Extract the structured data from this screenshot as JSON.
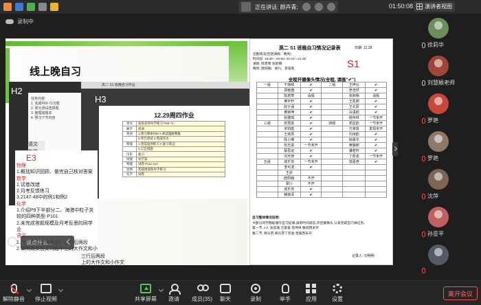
{
  "topbar": {
    "speaking_label": "正在讲话: 颜卉青;",
    "clock": "01:50:08",
    "view_label": "演讲者视图"
  },
  "recording_label": "录制中",
  "slide": {
    "title": "线上晚自习",
    "h2_label": "H2",
    "h2_lines": [
      "任务内容:",
      "1. 完成P69-72习题",
      "2. 单元测试选择题",
      "3. 整理错题本",
      "4. 预习下节内容"
    ],
    "h2_tabs": [
      "语文",
      "数学",
      "",
      "英语",
      "物理",
      "历史"
    ],
    "h3_header": "高二 S1 班晚自习作业",
    "h3_label": "H3",
    "h3_doc_title": "12.29周四作业",
    "h3_rows": [
      [
        "语文",
        "名校名师导学练习 P68-71"
      ],
      [
        "数学",
        "周测"
      ],
      [
        "英语",
        "1.预习课本P89 2.阅读理解两篇"
      ],
      [
        "",
        "3.单元测试 4.完成作文"
      ],
      [
        "物理",
        "1.完成电场练习 2.复习笔记"
      ],
      [
        "",
        "3.订正错题"
      ],
      [
        "历史",
        "复习"
      ],
      [
        "地理",
        "导学案"
      ],
      [
        "物理",
        "试卷 P111-112"
      ],
      [
        "生物",
        "完成周测及导学练习"
      ],
      [
        "化学",
        "试卷"
      ]
    ],
    "e3_label": "E3",
    "e3_lines": [
      {
        "t": "物理",
        "c": "red"
      },
      {
        "t": "1.概括知识回顾、做完自己核对答案",
        "c": "blk"
      },
      {
        "t": "数学",
        "c": "red"
      },
      {
        "t": "1.试卷改错",
        "c": "blk"
      },
      {
        "t": "2.月考反馈练习",
        "c": "blk"
      },
      {
        "t": "3.2147-48中的例1和例2",
        "c": "blk"
      },
      {
        "t": "化学",
        "c": "red"
      },
      {
        "t": "1.介绍P9下半部分二、海港中粒子关",
        "c": "blk"
      },
      {
        "t": "较的四种类型-P101",
        "c": "blk"
      },
      {
        "t": "2.未完成答题规模及月考反思的同学",
        "c": "blk"
      },
      {
        "t": "业",
        "c": "blk"
      },
      {
        "t": "语文",
        "c": "red"
      },
      {
        "t": "1.《五代史伶官传序》三行后两段",
        "c": "blk"
      },
      {
        "t": "2.做明清文言文习题中上的大作文和小作文",
        "c": "blk"
      }
    ],
    "e3_right_lines": [
      "三行后两段",
      "上的大作文和小作文"
    ],
    "chat_placeholder": "说点什么..."
  },
  "sheet": {
    "title": "高二 S1 班晚自习情况记录表",
    "date_label": "日期:",
    "date": "12.28",
    "s1_label": "S1",
    "attend_lines": [
      "出勤情况(包括请假、晚到)",
      "时间段: 18:30—20:00;  20:10—21:30",
      "请假:  陈若寒   张默赐",
      "晚到: 欧阳翰、梁川、李浩南"
    ],
    "attendance_title": "全程开摄像头情况(全程, 请画\"✔\")",
    "rows": [
      [
        "一组",
        "于雨晴",
        "✔",
        "二组",
        "王梓仪",
        "✔"
      ],
      [
        "",
        "郑敏雅",
        "✔",
        "",
        "罗浩然",
        "✔"
      ],
      [
        "",
        "陈若寒",
        "请假",
        "",
        "张默赐",
        "请假"
      ],
      [
        "",
        "黄宇轩",
        "✔",
        "",
        "王凯丽",
        "✔"
      ],
      [
        "",
        "赵子涵",
        "✔",
        "",
        "王北辰",
        "✔"
      ],
      [
        "",
        "黄锦坤",
        "✔",
        "",
        "白语莉",
        "✔"
      ],
      [
        "",
        "张雅琪",
        "✔",
        "",
        "聂伟林",
        "一节未开"
      ],
      [
        "三组",
        "张慧雯",
        "✔",
        "四组",
        "郭星韵",
        "一节未开"
      ],
      [
        "",
        "宋钧庭",
        "✔",
        "",
        "万家俊",
        "发现未开"
      ],
      [
        "",
        "王奕辰",
        "✔",
        "",
        "刘诗韵",
        "✔"
      ],
      [
        "",
        "陈小琳",
        "✔",
        "",
        "徐晨光",
        "✔"
      ],
      [
        "",
        "张志豪",
        "一节未开",
        "",
        "黄静丽",
        "✔"
      ],
      [
        "",
        "蔡思远",
        "✔",
        "",
        "潘若轩",
        "✔"
      ],
      [
        "",
        "刘天琦",
        "✔",
        "",
        "丁凯逸",
        "一节未开"
      ],
      [
        "五组",
        "龚乐苏",
        "一节未开",
        "",
        "曾嘉杏",
        "✔"
      ],
      [
        "",
        "李可滨",
        "✔",
        "",
        "",
        ""
      ],
      [
        "",
        "王逊",
        "",
        "",
        "",
        ""
      ],
      [
        "",
        "欧阳翰",
        "不开",
        "",
        "",
        ""
      ],
      [
        "",
        "梁川",
        "不开",
        "",
        "",
        ""
      ],
      [
        "",
        "龚乐苏",
        "✔",
        "",
        "",
        ""
      ],
      [
        "",
        "赖婧泽",
        "✔",
        "",
        "",
        ""
      ]
    ],
    "notes": [
      "自习整体情况说明:",
      "大部分同学都能遵守自习纪律,具有时间观念,开启摄像头,认真完成自习课任务。",
      "第一节: 4人   张奕辰   方家俊   聂伟林  散班晓未开",
      "第二节: 龚乐苏  龚乐苏丁凯逸  曾嘉杏未开"
    ],
    "recorder": "记录人:   刘明明"
  },
  "participants": [
    {
      "name": "徐莉华",
      "color": "#6b8e5a",
      "mic": "on"
    },
    {
      "name": "刘慧颖老师",
      "color": "#a34536",
      "mic": "on"
    },
    {
      "name": "罗艳",
      "color": "#c9463c",
      "mic": "off"
    },
    {
      "name": "罗艳",
      "color": "#8c7a66",
      "mic": "off"
    },
    {
      "name": "沈萍",
      "color": "#7c6552",
      "mic": "off"
    },
    {
      "name": "孙亚平",
      "color": "#c06060",
      "mic": "off"
    },
    {
      "name": "",
      "color": "#555a66",
      "mic": "off"
    }
  ],
  "toolbar": {
    "mute": "解除静音",
    "video": "停止视频",
    "share": "共享屏幕",
    "invite": "邀请",
    "members": "成员(35)",
    "chat": "聊天",
    "record": "录制",
    "raise_hand": "举手",
    "apps": "应用",
    "settings": "设置",
    "leave": "离开会议"
  }
}
